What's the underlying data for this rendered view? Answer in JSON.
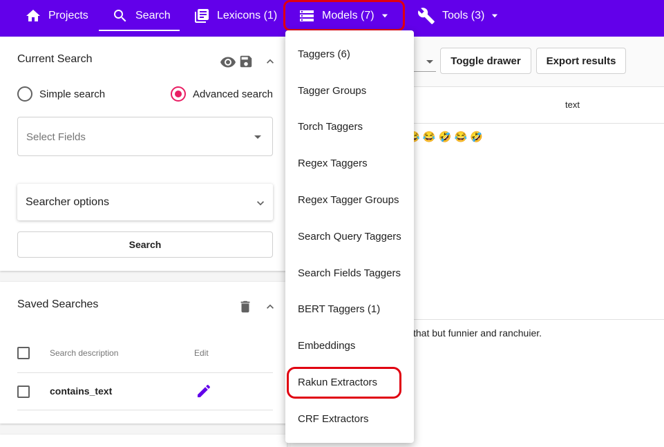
{
  "nav": {
    "projects": "Projects",
    "search": "Search",
    "lexicons": "Lexicons (1)",
    "models": "Models (7)",
    "tools": "Tools (3)"
  },
  "current_search": {
    "title": "Current Search",
    "simple": "Simple search",
    "advanced": "Advanced search",
    "selected_mode": "Advanced search",
    "fields_placeholder": "Select Fields",
    "searcher_options": "Searcher options",
    "search_button": "Search"
  },
  "saved_searches": {
    "title": "Saved Searches",
    "col_description": "Search description",
    "col_edit": "Edit",
    "rows": [
      {
        "description": "contains_text"
      }
    ]
  },
  "toolbar": {
    "toggle_drawer": "Toggle drawer",
    "export_results": "Export results"
  },
  "results": {
    "column_text": "text",
    "row1_text": "😂 😂 🤣 😂 🤣",
    "row2_text": "that but funnier and ranchuier."
  },
  "models_menu": {
    "items": [
      "Taggers (6)",
      "Tagger Groups",
      "Torch Taggers",
      "Regex Taggers",
      "Regex Tagger Groups",
      "Search Query Taggers",
      "Search Fields Taggers",
      "BERT Taggers (1)",
      "Embeddings",
      "Rakun Extractors",
      "CRF Extractors"
    ]
  },
  "colors": {
    "primary": "#6200ea",
    "accent": "#e91e63",
    "highlight": "#e00010",
    "edit_icon": "#6200ea"
  }
}
